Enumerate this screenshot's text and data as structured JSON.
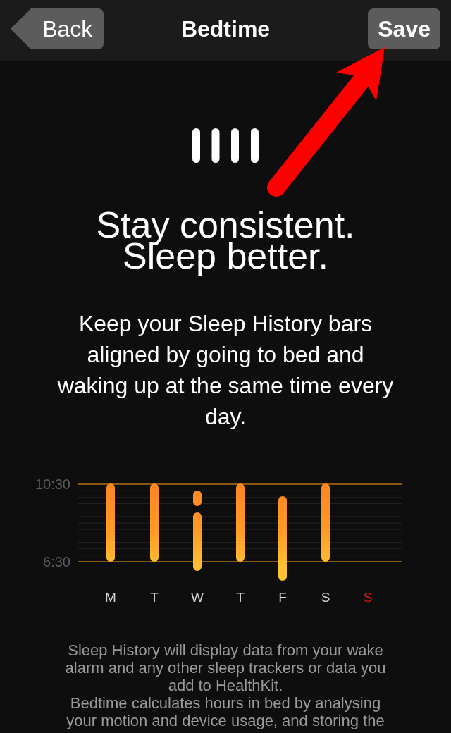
{
  "header": {
    "back_button": "Back",
    "title": "Bedtime",
    "save_button": "Save"
  },
  "headline": [
    "Stay consistent.",
    "Sleep better."
  ],
  "intro": "Keep your Sleep History bars aligned by going to bed and waking up at the same time every day.",
  "sleep_chart": {
    "y_labels": [
      "10:30",
      "6:30"
    ],
    "days": [
      {
        "label": "M",
        "color": "#d6d6d6"
      },
      {
        "label": "T",
        "color": "#d6d6d6"
      },
      {
        "label": "W",
        "color": "#d6d6d6"
      },
      {
        "label": "T",
        "color": "#d6d6d6"
      },
      {
        "label": "F",
        "color": "#d6d6d6"
      },
      {
        "label": "S",
        "color": "#d6d6d6"
      },
      {
        "label": "S",
        "color": "#e3121b"
      }
    ]
  },
  "footnote": [
    "Sleep History will display data from your wake alarm and any other sleep trackers or data you add to HealthKit.",
    "Bedtime calculates hours in bed by analysing your motion and device usage, and storing the"
  ]
}
